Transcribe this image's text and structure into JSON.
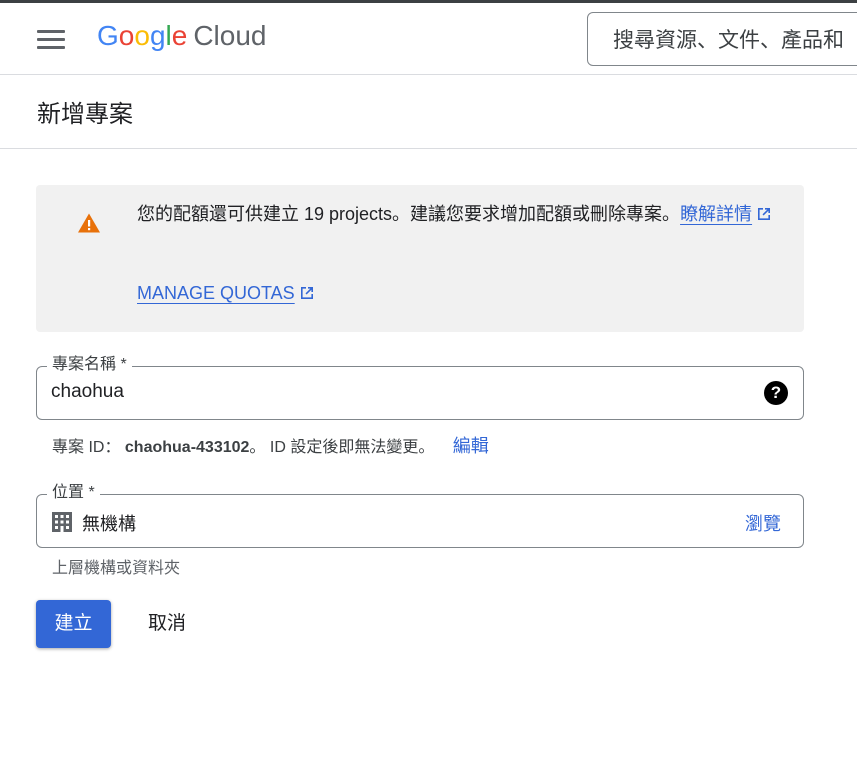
{
  "header": {
    "logo": {
      "letters": [
        "G",
        "o",
        "o",
        "g",
        "l",
        "e"
      ],
      "letter_colors": [
        "#4285F4",
        "#EA4335",
        "#FBBC05",
        "#4285F4",
        "#34A853",
        "#EA4335"
      ],
      "product": "Cloud"
    },
    "search": {
      "placeholder": "搜尋資源、文件、產品和"
    },
    "menu_icon": "hamburger-menu-icon"
  },
  "page": {
    "title": "新增專案"
  },
  "quota_banner": {
    "icon": "warning-icon",
    "icon_color": "#e8710a",
    "message": "您的配額還可供建立 19 projects。建議您要求增加配額或刪除專案。",
    "learn_more_label": "瞭解詳情",
    "manage_quotas_label": "MANAGE QUOTAS",
    "external_link_icon": "external-link-icon"
  },
  "project_name": {
    "label": "專案名稱 *",
    "value": "chaohua",
    "help_icon": "help-icon"
  },
  "project_id": {
    "prefix": "專案 ID：",
    "id": "chaohua-433102",
    "suffix": "。 ID 設定後即無法變更。",
    "edit_label": "編輯"
  },
  "location": {
    "label": "位置 *",
    "value": "無機構",
    "icon": "organization-icon",
    "browse_label": "瀏覽",
    "hint": "上層機構或資料夾"
  },
  "actions": {
    "create_label": "建立",
    "cancel_label": "取消"
  },
  "colors": {
    "link": "#3367d6",
    "primary_button": "#3367d6",
    "banner_background": "#f1f1f1"
  }
}
